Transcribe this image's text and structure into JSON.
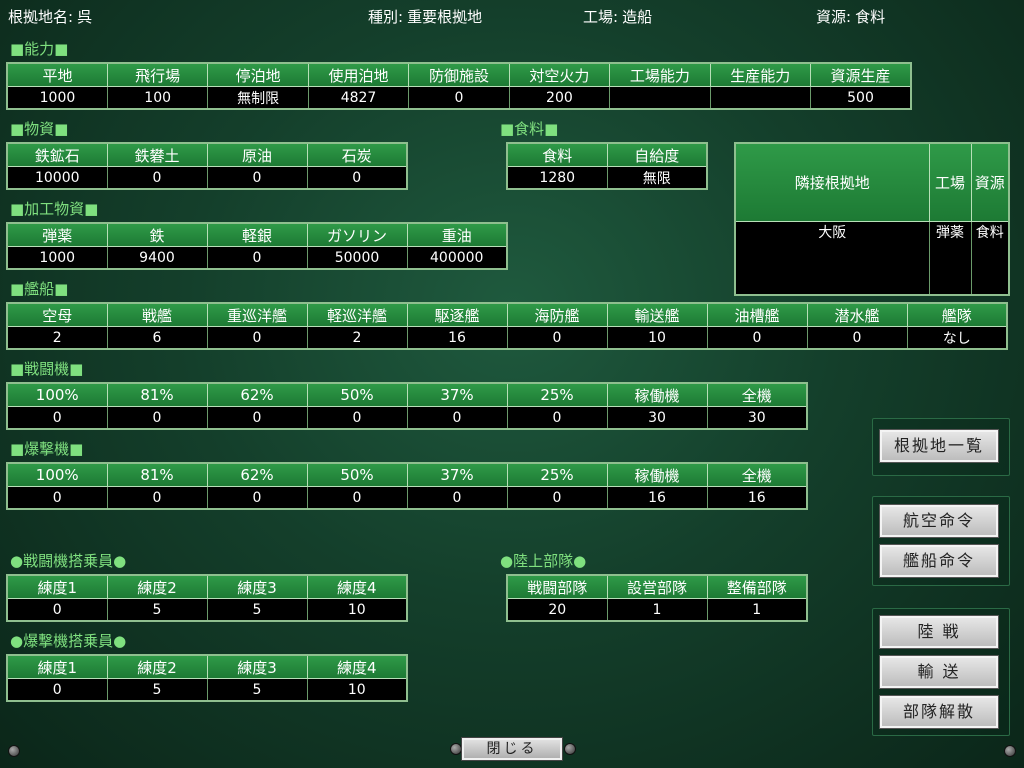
{
  "header": {
    "base_label": "根拠地名:",
    "base_value": "呉",
    "type_label": "種別:",
    "type_value": "重要根拠地",
    "factory_label": "工場:",
    "factory_value": "造船",
    "resource_label": "資源:",
    "resource_value": "食料"
  },
  "ability": {
    "title": "■能力■",
    "headers": [
      "平地",
      "飛行場",
      "停泊地",
      "使用泊地",
      "防御施設",
      "対空火力",
      "工場能力",
      "生産能力",
      "資源生産"
    ],
    "values": [
      "1000",
      "100",
      "無制限",
      "4827",
      "0",
      "200",
      "",
      "",
      "500"
    ]
  },
  "materials": {
    "title": "■物資■",
    "headers": [
      "鉄鉱石",
      "鉄礬土",
      "原油",
      "石炭"
    ],
    "values": [
      "10000",
      "0",
      "0",
      "0"
    ]
  },
  "food": {
    "title": "■食料■",
    "headers": [
      "食料",
      "自給度"
    ],
    "values": [
      "1280",
      "無限"
    ]
  },
  "neighbors": {
    "headers": [
      "隣接根拠地",
      "工場",
      "資源"
    ],
    "rows": [
      [
        "大阪",
        "弾薬",
        "食料"
      ]
    ]
  },
  "processed": {
    "title": "■加工物資■",
    "headers": [
      "弾薬",
      "鉄",
      "軽銀",
      "ガソリン",
      "重油"
    ],
    "values": [
      "1000",
      "9400",
      "0",
      "50000",
      "400000"
    ]
  },
  "ships": {
    "title": "■艦船■",
    "headers": [
      "空母",
      "戦艦",
      "重巡洋艦",
      "軽巡洋艦",
      "駆逐艦",
      "海防艦",
      "輸送艦",
      "油槽艦",
      "潜水艦",
      "艦隊"
    ],
    "values": [
      "2",
      "6",
      "0",
      "2",
      "16",
      "0",
      "10",
      "0",
      "0",
      "なし"
    ]
  },
  "fighters": {
    "title": "■戦闘機■",
    "headers": [
      "100%",
      "81%",
      "62%",
      "50%",
      "37%",
      "25%",
      "稼働機",
      "全機"
    ],
    "values": [
      "0",
      "0",
      "0",
      "0",
      "0",
      "0",
      "30",
      "30"
    ]
  },
  "bombers": {
    "title": "■爆撃機■",
    "headers": [
      "100%",
      "81%",
      "62%",
      "50%",
      "37%",
      "25%",
      "稼働機",
      "全機"
    ],
    "values": [
      "0",
      "0",
      "0",
      "0",
      "0",
      "0",
      "16",
      "16"
    ]
  },
  "fighter_crew": {
    "title": "●戦闘機搭乗員●",
    "headers": [
      "練度1",
      "練度2",
      "練度3",
      "練度4"
    ],
    "values": [
      "0",
      "5",
      "5",
      "10"
    ]
  },
  "bomber_crew": {
    "title": "●爆撃機搭乗員●",
    "headers": [
      "練度1",
      "練度2",
      "練度3",
      "練度4"
    ],
    "values": [
      "0",
      "5",
      "5",
      "10"
    ]
  },
  "ground": {
    "title": "●陸上部隊●",
    "headers": [
      "戦闘部隊",
      "設営部隊",
      "整備部隊"
    ],
    "values": [
      "20",
      "1",
      "1"
    ]
  },
  "buttons": {
    "base_list": "根拠地一覧",
    "air_command": "航空命令",
    "ship_command": "艦船命令",
    "land_battle": "陸 戦",
    "transport": "輸 送",
    "disband": "部隊解散",
    "close": "閉じる"
  }
}
